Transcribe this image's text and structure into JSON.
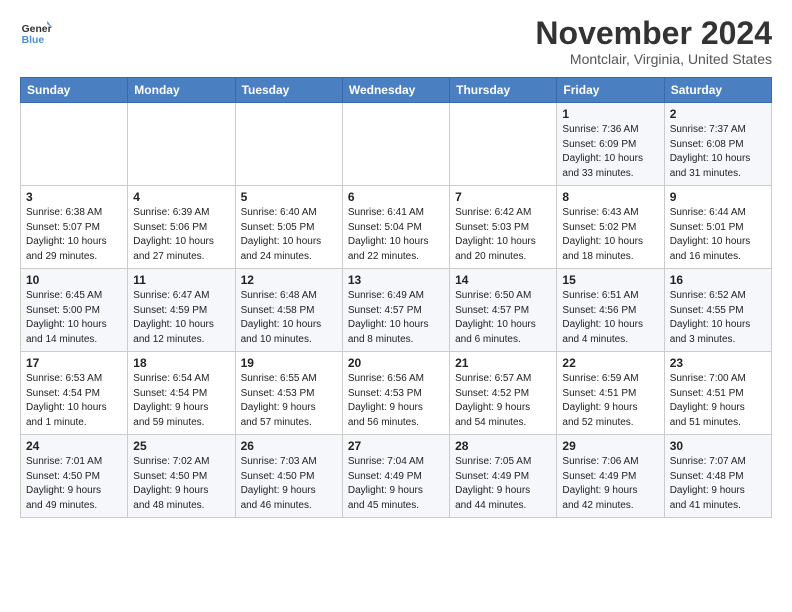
{
  "header": {
    "logo_line1": "General",
    "logo_line2": "Blue",
    "month": "November 2024",
    "location": "Montclair, Virginia, United States"
  },
  "weekdays": [
    "Sunday",
    "Monday",
    "Tuesday",
    "Wednesday",
    "Thursday",
    "Friday",
    "Saturday"
  ],
  "weeks": [
    [
      {
        "day": "",
        "info": ""
      },
      {
        "day": "",
        "info": ""
      },
      {
        "day": "",
        "info": ""
      },
      {
        "day": "",
        "info": ""
      },
      {
        "day": "",
        "info": ""
      },
      {
        "day": "1",
        "info": "Sunrise: 7:36 AM\nSunset: 6:09 PM\nDaylight: 10 hours\nand 33 minutes."
      },
      {
        "day": "2",
        "info": "Sunrise: 7:37 AM\nSunset: 6:08 PM\nDaylight: 10 hours\nand 31 minutes."
      }
    ],
    [
      {
        "day": "3",
        "info": "Sunrise: 6:38 AM\nSunset: 5:07 PM\nDaylight: 10 hours\nand 29 minutes."
      },
      {
        "day": "4",
        "info": "Sunrise: 6:39 AM\nSunset: 5:06 PM\nDaylight: 10 hours\nand 27 minutes."
      },
      {
        "day": "5",
        "info": "Sunrise: 6:40 AM\nSunset: 5:05 PM\nDaylight: 10 hours\nand 24 minutes."
      },
      {
        "day": "6",
        "info": "Sunrise: 6:41 AM\nSunset: 5:04 PM\nDaylight: 10 hours\nand 22 minutes."
      },
      {
        "day": "7",
        "info": "Sunrise: 6:42 AM\nSunset: 5:03 PM\nDaylight: 10 hours\nand 20 minutes."
      },
      {
        "day": "8",
        "info": "Sunrise: 6:43 AM\nSunset: 5:02 PM\nDaylight: 10 hours\nand 18 minutes."
      },
      {
        "day": "9",
        "info": "Sunrise: 6:44 AM\nSunset: 5:01 PM\nDaylight: 10 hours\nand 16 minutes."
      }
    ],
    [
      {
        "day": "10",
        "info": "Sunrise: 6:45 AM\nSunset: 5:00 PM\nDaylight: 10 hours\nand 14 minutes."
      },
      {
        "day": "11",
        "info": "Sunrise: 6:47 AM\nSunset: 4:59 PM\nDaylight: 10 hours\nand 12 minutes."
      },
      {
        "day": "12",
        "info": "Sunrise: 6:48 AM\nSunset: 4:58 PM\nDaylight: 10 hours\nand 10 minutes."
      },
      {
        "day": "13",
        "info": "Sunrise: 6:49 AM\nSunset: 4:57 PM\nDaylight: 10 hours\nand 8 minutes."
      },
      {
        "day": "14",
        "info": "Sunrise: 6:50 AM\nSunset: 4:57 PM\nDaylight: 10 hours\nand 6 minutes."
      },
      {
        "day": "15",
        "info": "Sunrise: 6:51 AM\nSunset: 4:56 PM\nDaylight: 10 hours\nand 4 minutes."
      },
      {
        "day": "16",
        "info": "Sunrise: 6:52 AM\nSunset: 4:55 PM\nDaylight: 10 hours\nand 3 minutes."
      }
    ],
    [
      {
        "day": "17",
        "info": "Sunrise: 6:53 AM\nSunset: 4:54 PM\nDaylight: 10 hours\nand 1 minute."
      },
      {
        "day": "18",
        "info": "Sunrise: 6:54 AM\nSunset: 4:54 PM\nDaylight: 9 hours\nand 59 minutes."
      },
      {
        "day": "19",
        "info": "Sunrise: 6:55 AM\nSunset: 4:53 PM\nDaylight: 9 hours\nand 57 minutes."
      },
      {
        "day": "20",
        "info": "Sunrise: 6:56 AM\nSunset: 4:53 PM\nDaylight: 9 hours\nand 56 minutes."
      },
      {
        "day": "21",
        "info": "Sunrise: 6:57 AM\nSunset: 4:52 PM\nDaylight: 9 hours\nand 54 minutes."
      },
      {
        "day": "22",
        "info": "Sunrise: 6:59 AM\nSunset: 4:51 PM\nDaylight: 9 hours\nand 52 minutes."
      },
      {
        "day": "23",
        "info": "Sunrise: 7:00 AM\nSunset: 4:51 PM\nDaylight: 9 hours\nand 51 minutes."
      }
    ],
    [
      {
        "day": "24",
        "info": "Sunrise: 7:01 AM\nSunset: 4:50 PM\nDaylight: 9 hours\nand 49 minutes."
      },
      {
        "day": "25",
        "info": "Sunrise: 7:02 AM\nSunset: 4:50 PM\nDaylight: 9 hours\nand 48 minutes."
      },
      {
        "day": "26",
        "info": "Sunrise: 7:03 AM\nSunset: 4:50 PM\nDaylight: 9 hours\nand 46 minutes."
      },
      {
        "day": "27",
        "info": "Sunrise: 7:04 AM\nSunset: 4:49 PM\nDaylight: 9 hours\nand 45 minutes."
      },
      {
        "day": "28",
        "info": "Sunrise: 7:05 AM\nSunset: 4:49 PM\nDaylight: 9 hours\nand 44 minutes."
      },
      {
        "day": "29",
        "info": "Sunrise: 7:06 AM\nSunset: 4:49 PM\nDaylight: 9 hours\nand 42 minutes."
      },
      {
        "day": "30",
        "info": "Sunrise: 7:07 AM\nSunset: 4:48 PM\nDaylight: 9 hours\nand 41 minutes."
      }
    ]
  ]
}
